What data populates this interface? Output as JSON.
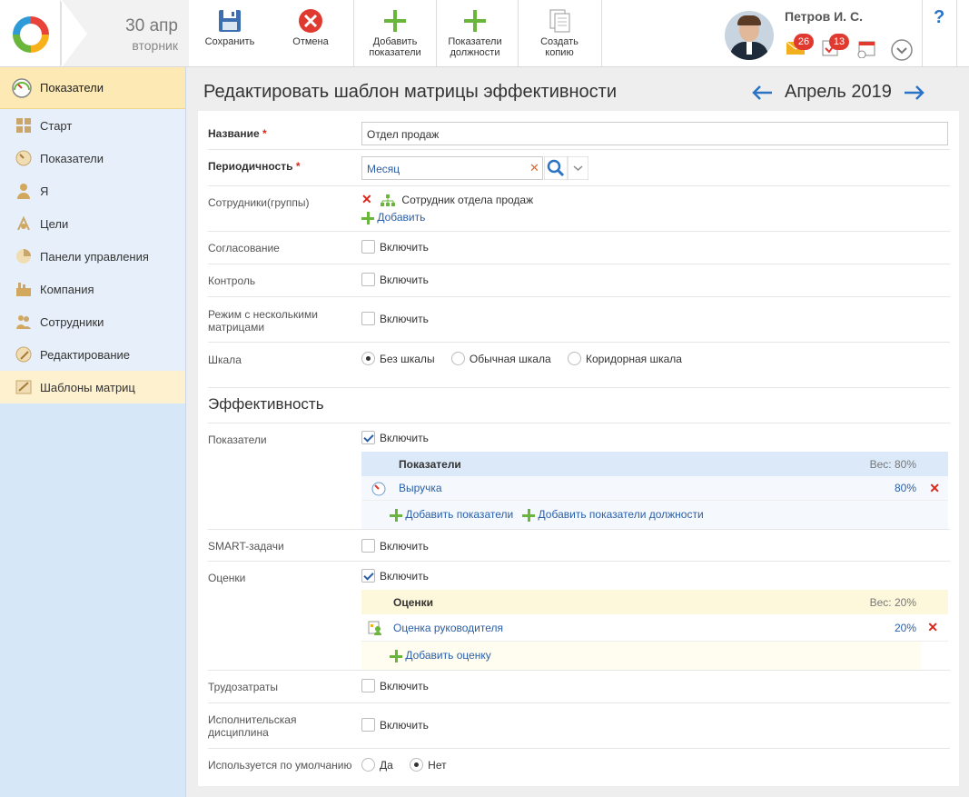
{
  "header": {
    "date_day": "30 апр",
    "date_weekday": "вторник",
    "toolbar": {
      "save": "Сохранить",
      "cancel": "Отмена",
      "add_indicators_1": "Добавить",
      "add_indicators_2": "показатели",
      "position_indicators_1": "Показатели",
      "position_indicators_2": "должности",
      "create_copy_1": "Создать",
      "create_copy_2": "копию"
    },
    "user_name": "Петров И. С.",
    "messages_count": "26",
    "tasks_count": "13",
    "help": "?"
  },
  "sidebar": {
    "header": "Показатели",
    "items": [
      {
        "label": "Старт"
      },
      {
        "label": "Показатели"
      },
      {
        "label": "Я"
      },
      {
        "label": "Цели"
      },
      {
        "label": "Панели управления"
      },
      {
        "label": "Компания"
      },
      {
        "label": "Сотрудники"
      },
      {
        "label": "Редактирование"
      },
      {
        "label": "Шаблоны матриц"
      }
    ]
  },
  "main": {
    "title": "Редактировать шаблон матрицы эффективности",
    "period": "Апрель 2019",
    "form": {
      "name_label": "Название",
      "name_value": "Отдел продаж",
      "periodicity_label": "Периодичность",
      "periodicity_value": "Месяц",
      "employees_label": "Сотрудники(группы)",
      "employee_item": "Сотрудник отдела продаж",
      "add_label": "Добавить",
      "approval_label": "Согласование",
      "control_label": "Контроль",
      "multi_label_1": "Режим с несколькими",
      "multi_label_2": "матрицами",
      "enable": "Включить",
      "scale_label": "Шкала",
      "scale_options": [
        "Без шкалы",
        "Обычная шкала",
        "Коридорная шкала"
      ],
      "scale_selected": "Без шкалы"
    },
    "efficiency": {
      "section_title": "Эффективность",
      "indicators_label": "Показатели",
      "indicators_table": {
        "header": "Показатели",
        "weight": "Вес: 80%",
        "rows": [
          {
            "name": "Выручка",
            "value": "80%"
          }
        ],
        "add_indicators": "Добавить показатели",
        "add_position_indicators": "Добавить показатели должности"
      },
      "smart_label": "SMART-задачи",
      "ratings_label": "Оценки",
      "ratings_table": {
        "header": "Оценки",
        "weight": "Вес: 20%",
        "rows": [
          {
            "name": "Оценка руководителя",
            "value": "20%"
          }
        ],
        "add_rating": "Добавить оценку"
      },
      "labor_label": "Трудозатраты",
      "discipline_label_1": "Исполнительская",
      "discipline_label_2": "дисциплина",
      "default_label": "Используется по умолчанию",
      "default_options": [
        "Да",
        "Нет"
      ],
      "default_selected": "Нет"
    }
  },
  "colors": {
    "accent_blue": "#2a5fa8",
    "red": "#d9261c",
    "green": "#6ab53c",
    "sidebar_bg": "#d6e7f8",
    "sidebar_header": "#fde9b4"
  }
}
